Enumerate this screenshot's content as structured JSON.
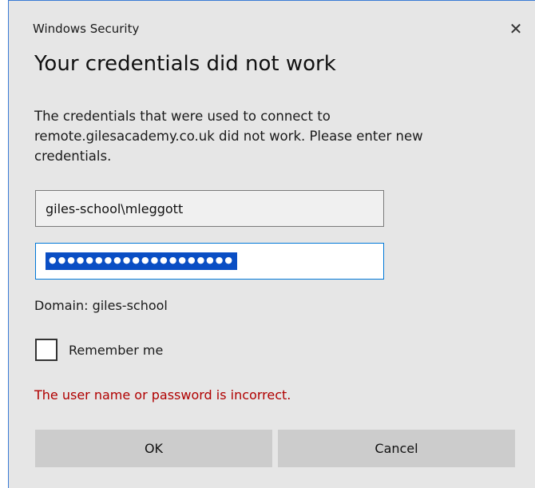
{
  "window": {
    "title": "Windows Security",
    "close_glyph": "✕"
  },
  "dialog": {
    "heading": "Your credentials did not work",
    "message_line1": "The credentials that were used to connect to",
    "message_line2": "remote.gilesacademy.co.uk did not work. Please enter new",
    "message_line3": "credentials.",
    "username_value": "giles-school\\mleggott",
    "password_mask": "●●●●●●●●●●●●●●●●●●●●",
    "domain_text": "Domain: giles-school",
    "remember_label": "Remember me",
    "remember_checked": false,
    "error_text": "The user name or password is incorrect."
  },
  "buttons": {
    "ok": "OK",
    "cancel": "Cancel"
  },
  "colors": {
    "error": "#b00000",
    "focus_border": "#0078d7",
    "selection": "#0a4ec4"
  }
}
